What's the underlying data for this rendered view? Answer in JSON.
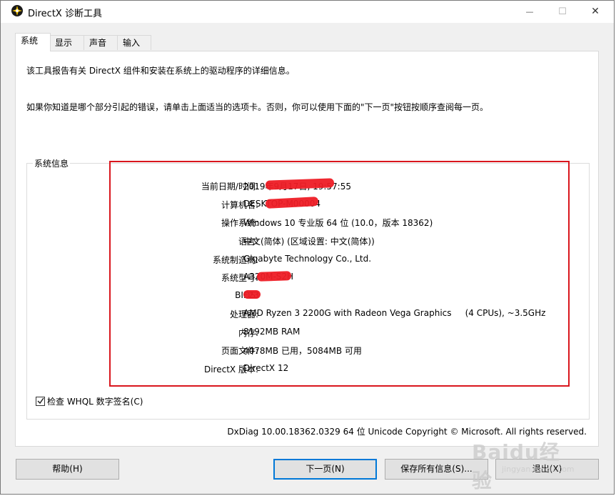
{
  "window": {
    "title": "DirectX 诊断工具",
    "controls": {
      "minimize": "—",
      "maximize": "☐",
      "close": "✕"
    }
  },
  "tabs": [
    {
      "label": "系统",
      "active": true
    },
    {
      "label": "显示",
      "active": false
    },
    {
      "label": "声音",
      "active": false
    },
    {
      "label": "输入",
      "active": false
    }
  ],
  "intro": {
    "line1": "该工具报告有关 DirectX 组件和安装在系统上的驱动程序的详细信息。",
    "line2": "如果你知道是哪个部分引起的错误，请单击上面适当的选项卡。否则，你可以使用下面的\"下一页\"按钮按顺序查阅每一页。"
  },
  "system_info": {
    "group_label": "系统信息",
    "rows": [
      {
        "label": "当前日期/时间:",
        "value": "2019年9月17日, 19:57:55"
      },
      {
        "label": "计算机名:",
        "value": "DESKTOP-M00004"
      },
      {
        "label": "操作系统:",
        "value": "Windows 10 专业版 64 位 (10.0，版本 18362)"
      },
      {
        "label": "语言:",
        "value": "中文(简体) (区域设置: 中文(简体))"
      },
      {
        "label": "系统制造商:",
        "value": "Gigabyte Technology Co., Ltd."
      },
      {
        "label": "系统型号:",
        "value": "A320M-S2H"
      },
      {
        "label": "BIOS:",
        "value": "F23"
      },
      {
        "label": "处理器:",
        "value": "AMD Ryzen 3 2200G with Radeon Vega Graphics     (4 CPUs), ~3.5GHz"
      },
      {
        "label": "内存:",
        "value": "8192MB RAM"
      },
      {
        "label": "页面文件:",
        "value": "4078MB 已用，5084MB 可用"
      },
      {
        "label": "DirectX 版本:",
        "value": "DirectX 12"
      }
    ]
  },
  "whql": {
    "label": "检查 WHQL 数字签名(C)",
    "checked": true
  },
  "version_line": "DxDiag 10.00.18362.0329 64 位 Unicode  Copyright © Microsoft. All rights reserved.",
  "buttons": {
    "help": "帮助(H)",
    "next": "下一页(N)",
    "save_all": "保存所有信息(S)...",
    "exit": "退出(X)"
  },
  "watermark": {
    "main": "Baidu经验",
    "sub": "jingyan.baidu.com"
  },
  "colors": {
    "highlight_box": "#d9161d",
    "redaction": "#ee1c25",
    "default_button_border": "#0078d7"
  },
  "icons": {
    "app": "directx-icon",
    "checkbox": "check-icon"
  }
}
